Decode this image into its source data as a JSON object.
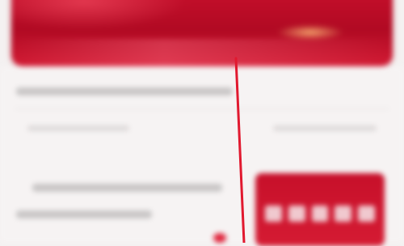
{
  "banner": {
    "title": ""
  },
  "list": {
    "title": "",
    "meta_left": "",
    "meta_right": "",
    "card_line_1": "",
    "card_line_2": ""
  },
  "promo": {
    "label": ""
  },
  "colors": {
    "brand_red": "#c8102c",
    "annotation_line": "#e1192f",
    "page_background": "#f6f3f3"
  }
}
